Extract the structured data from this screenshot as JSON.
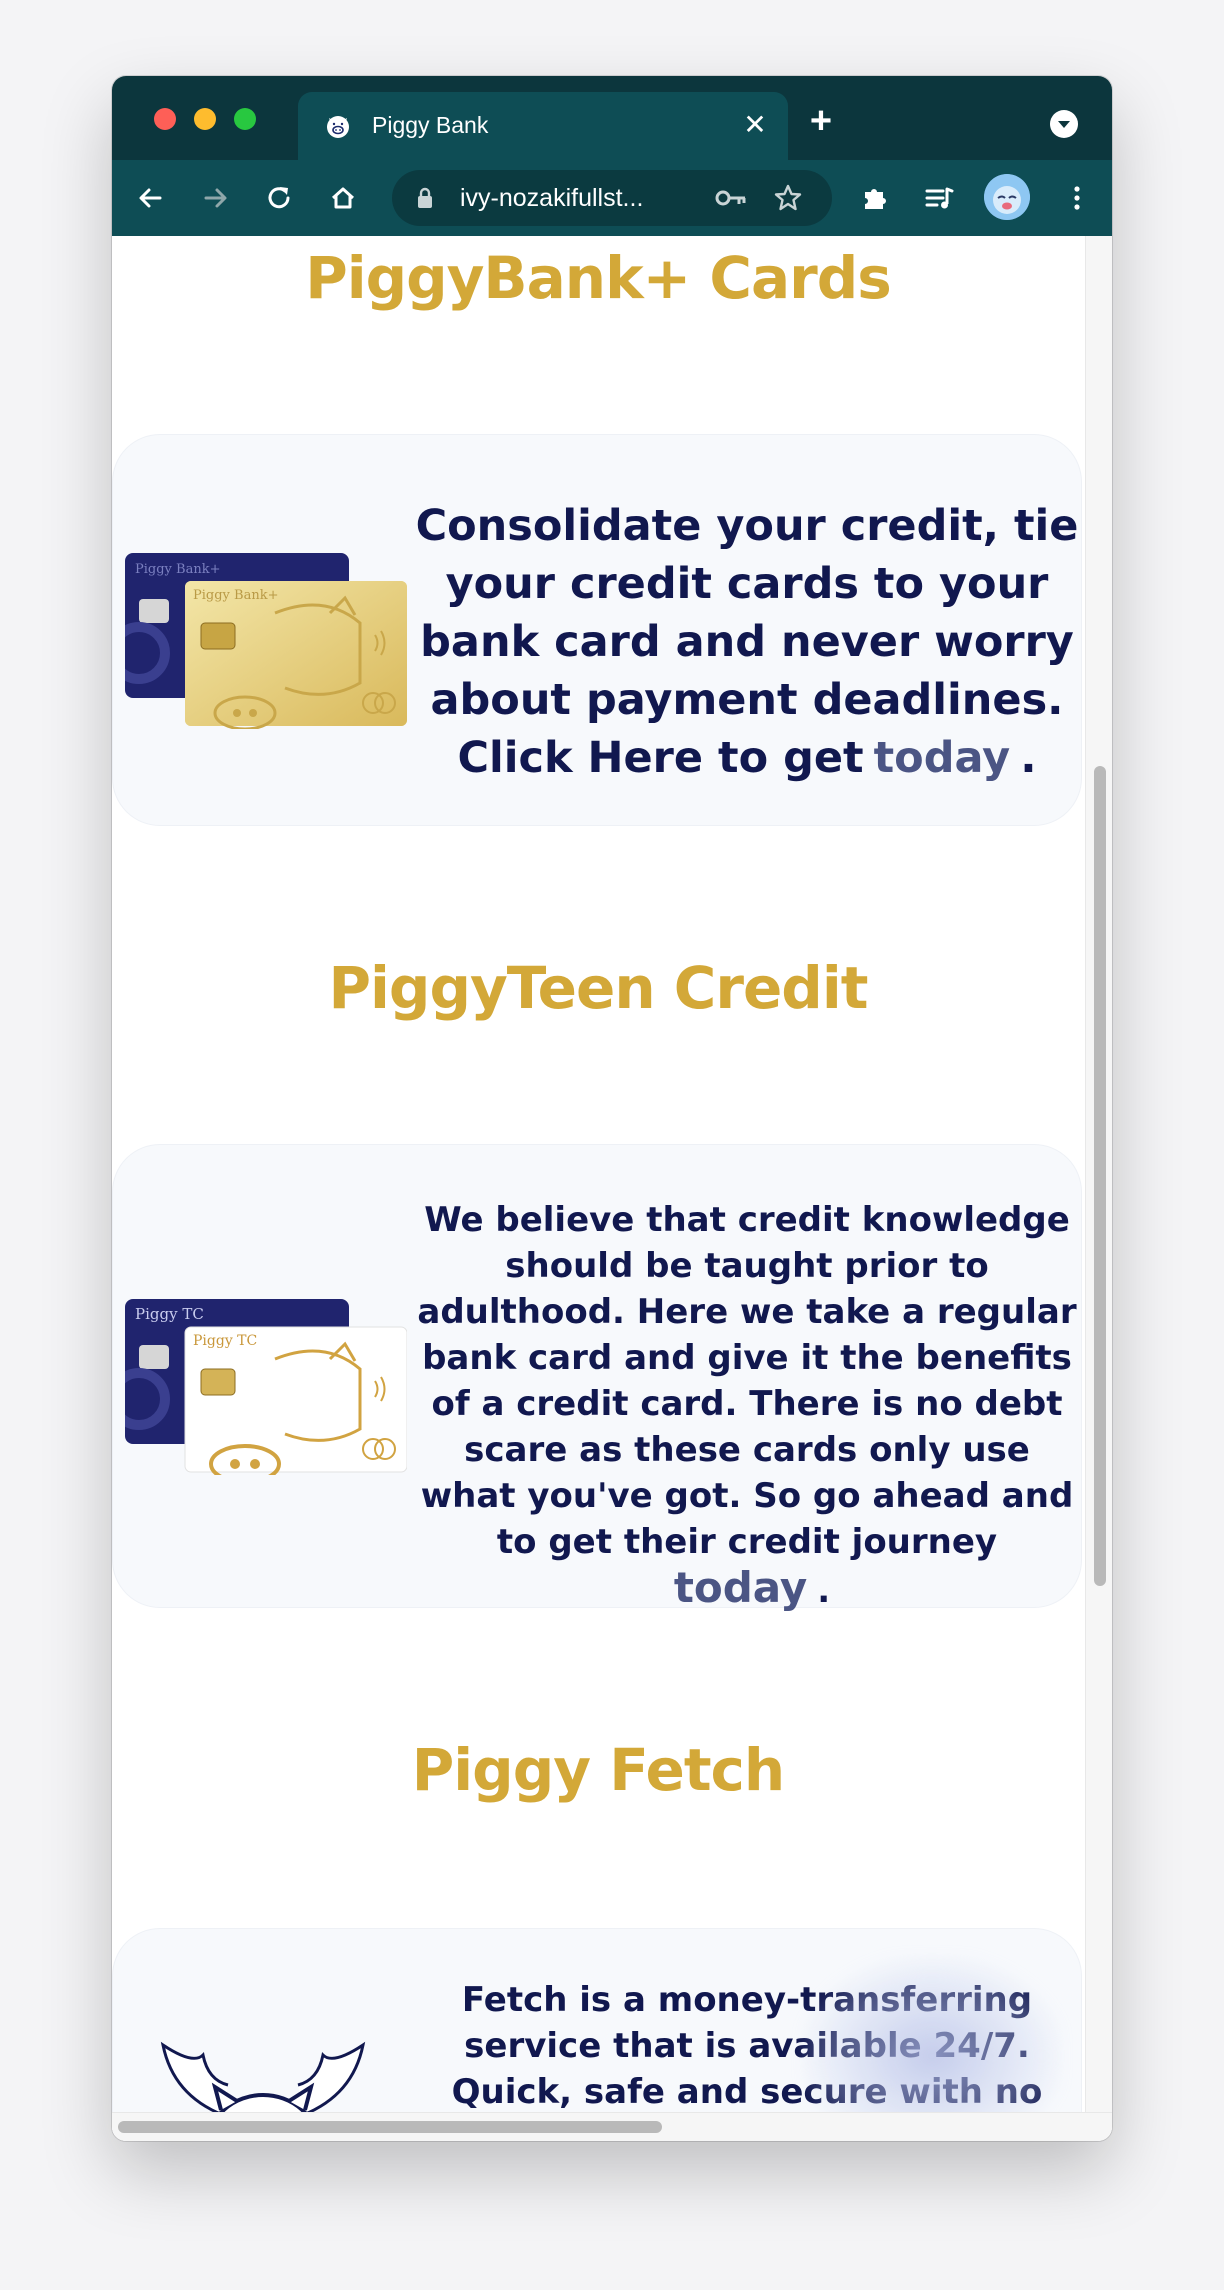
{
  "browser": {
    "tab_title": "Piggy Bank",
    "address": "ivy-nozakifullst...",
    "new_tab_label": "+",
    "close_tab_label": "✕"
  },
  "sections": [
    {
      "title": "PiggyBank+ Cards",
      "text": "Consolidate your credit, tie your credit cards to your bank card and never worry about payment deadlines. Click Here to get",
      "link": "today",
      "end": ".",
      "card_back_label": "Piggy Bank+",
      "card_front_label": "Piggy Bank+"
    },
    {
      "title": "PiggyTeen Credit",
      "text": "We believe that credit knowledge should be taught prior to adulthood. Here we take a regular bank card and give it the benefits of a credit card. There is no debt scare as these cards only use what you've got. So go ahead and to get their credit journey",
      "link": "today",
      "end": ".",
      "card_back_label": "Piggy TC",
      "card_front_label": "Piggy TC"
    },
    {
      "title": "Piggy Fetch",
      "text": "Fetch is a money-transferring service that is available 24/7. Quick, safe and secure with no additional charges. Piggy Bank has it covered for your family and friends. Start sending"
    }
  ],
  "colors": {
    "title_gold": "#d3a838",
    "body_navy": "#11184f",
    "link_slate": "#4b5584",
    "chrome_dark": "#0c363d",
    "chrome_teal": "#0e4d55"
  }
}
